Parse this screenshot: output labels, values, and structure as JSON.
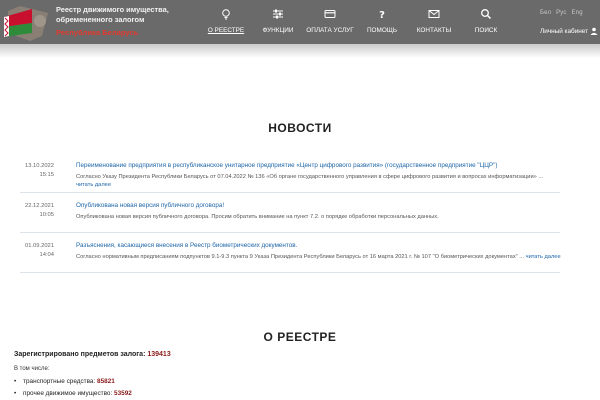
{
  "header": {
    "title": "Реестр движимого имущества, обремененного залогом",
    "subtitle": "Республика Беларусь",
    "nav": [
      {
        "label": "О РЕЕСТРЕ",
        "icon": "lightbulb-icon"
      },
      {
        "label": "ФУНКЦИИ",
        "icon": "sliders-icon"
      },
      {
        "label": "ОПЛАТА УСЛУГ",
        "icon": "credit-card-icon"
      },
      {
        "label": "ПОМОЩЬ",
        "icon": "question-icon"
      },
      {
        "label": "КОНТАКТЫ",
        "icon": "envelope-icon"
      },
      {
        "label": "ПОИСК",
        "icon": "search-icon"
      }
    ],
    "languages": [
      "Бел",
      "Рус",
      "Eng"
    ],
    "cabinet": "Личный кабинет"
  },
  "news": {
    "heading": "НОВОСТИ",
    "items": [
      {
        "date": "13.10.2022",
        "time": "15:15",
        "title": "Переименование предприятия в республиканское унитарное предприятие «Центр цифрового развития» (государственное предприятие \"ЦЦР\")",
        "text": "Согласно Указу Президента Республики Беларусь от 07.04.2022 № 136 «Об органе государственного управления в сфере цифрового развития и вопросах информатизации» ...",
        "more": "читать далее"
      },
      {
        "date": "22.12.2021",
        "time": "10:05",
        "title": "Опубликована новая версия публичного договора!",
        "text": "Опубликована новая версия публичного договора. Просим обратить внимание на пункт 7.2. о порядке обработки персональных данных.",
        "more": ""
      },
      {
        "date": "01.09.2021",
        "time": "14:04",
        "title": "Разъяснения, касающиеся внесения в Реестр биометрических документов.",
        "text": "Согласно нормативным предписаниям подпунктов 9.1-9.3 пункта 9 Указа Президента Республики Беларусь от 16 марта 2021 г. № 107 \"О биометрических документах\" ...",
        "more": "читать далее"
      }
    ]
  },
  "about": {
    "heading": "О РЕЕСТРЕ",
    "registered_label": "Зарегистрировано предметов залога:",
    "registered_value": "139413",
    "including": "В том числе:",
    "stats": [
      {
        "label": "транспортные средства:",
        "value": "85821"
      },
      {
        "label": "прочее движимое имущество:",
        "value": "53592"
      }
    ]
  },
  "colors": {
    "header_bg": "#6a6a6a",
    "link": "#1d65a8",
    "accent_red": "#e23b2e",
    "number": "#8b1a1a"
  }
}
